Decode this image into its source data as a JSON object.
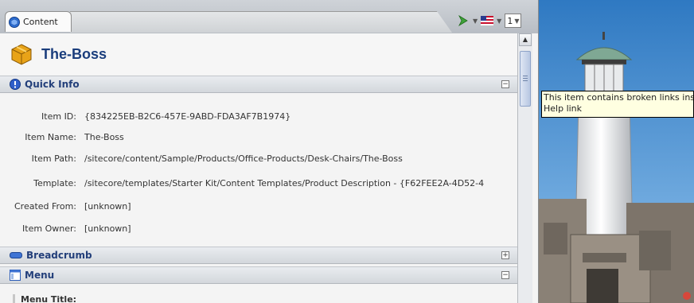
{
  "tab": {
    "label": "Content",
    "version": "1"
  },
  "item": {
    "name": "The-Boss"
  },
  "sections": {
    "quick_info": {
      "title": "Quick Info"
    },
    "breadcrumb": {
      "title": "Breadcrumb"
    },
    "menu": {
      "title": "Menu"
    }
  },
  "fields": [
    {
      "label": "Item ID:",
      "value": "{834225EB-B2C6-457E-9ABD-FDA3AF7B1974}"
    },
    {
      "label": "Item Name:",
      "value": "The-Boss"
    },
    {
      "label": "Item Path:",
      "value": "/sitecore/content/Sample/Products/Office-Products/Desk-Chairs/The-Boss"
    },
    {
      "label": "Template:",
      "value": "/sitecore/templates/Starter Kit/Content Templates/Product Description - {F62FEE2A-4D52-4"
    },
    {
      "label": "Created From:",
      "value": "[unknown]"
    },
    {
      "label": "Item Owner:",
      "value": "[unknown]"
    }
  ],
  "menu_field": {
    "label": "Menu Title:"
  },
  "tooltip": {
    "line1": "This item contains broken links ins",
    "line2": "Help link"
  },
  "colors": {
    "title_blue": "#1a3d7c",
    "warning_yellow": "#f2c021",
    "tooltip_bg": "#ffffe1"
  }
}
